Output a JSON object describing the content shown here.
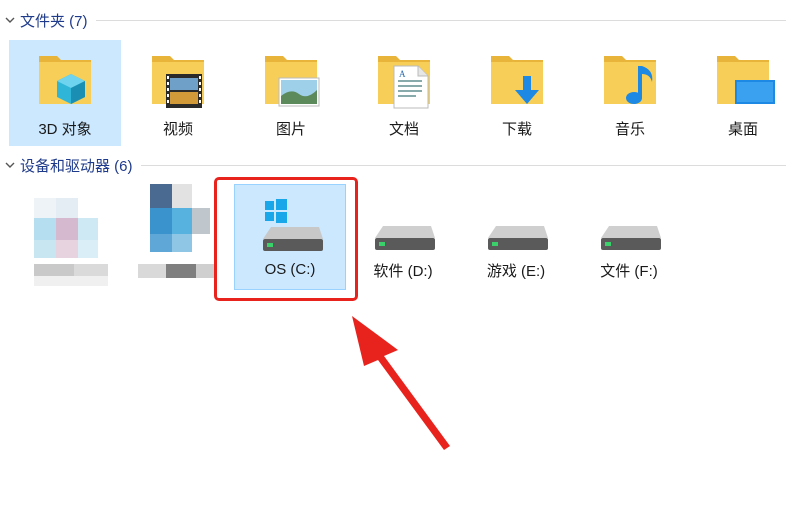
{
  "groups": {
    "folders": {
      "title": "文件夹 (7)"
    },
    "devices": {
      "title": "设备和驱动器 (6)"
    }
  },
  "folders": [
    {
      "label": "3D 对象",
      "icon": "3d-objects-folder-icon",
      "selected": true
    },
    {
      "label": "视频",
      "icon": "videos-folder-icon"
    },
    {
      "label": "图片",
      "icon": "pictures-folder-icon"
    },
    {
      "label": "文档",
      "icon": "documents-folder-icon"
    },
    {
      "label": "下载",
      "icon": "downloads-folder-icon"
    },
    {
      "label": "音乐",
      "icon": "music-folder-icon"
    },
    {
      "label": "桌面",
      "icon": "desktop-folder-icon"
    }
  ],
  "drives": [
    {
      "label": "OS (C:)",
      "icon": "windows-system-drive-icon",
      "selected": true,
      "highlighted": true
    },
    {
      "label": "软件 (D:)",
      "icon": "hard-drive-icon"
    },
    {
      "label": "游戏 (E:)",
      "icon": "hard-drive-icon"
    },
    {
      "label": "文件 (F:)",
      "icon": "hard-drive-icon"
    }
  ],
  "colors": {
    "selection": "#cce8ff",
    "group_title": "#1e3a8a",
    "highlight": "#e8231e",
    "folder_yellow": "#f7ce57"
  }
}
